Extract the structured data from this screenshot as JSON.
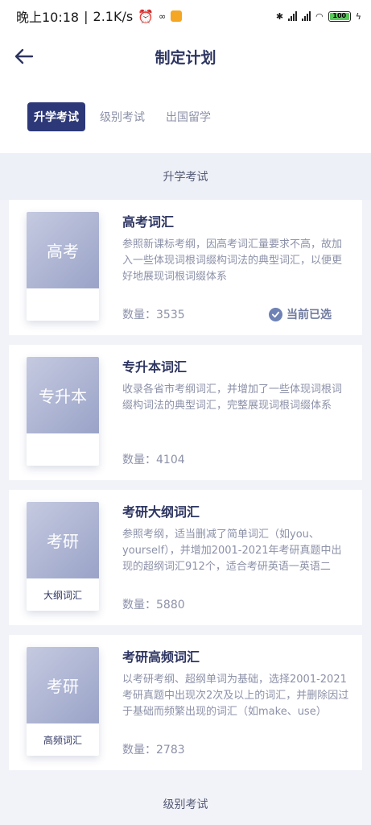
{
  "status": {
    "time": "晚上10:18",
    "speed": "2.1K/s",
    "battery": "100"
  },
  "nav": {
    "title": "制定计划"
  },
  "tabs": [
    {
      "label": "升学考试",
      "active": true
    },
    {
      "label": "级别考试",
      "active": false
    },
    {
      "label": "出国留学",
      "active": false
    }
  ],
  "sections": {
    "first": "升学考试",
    "second": "级别考试"
  },
  "books": [
    {
      "cover_main": "高考",
      "cover_sub": "",
      "title": "高考词汇",
      "desc": "参照新课标考纲，因高考词汇量要求不高，故加入一些体现词根词缀构词法的典型词汇，以便更好地展现词根词缀体系",
      "count": "数量：3535",
      "selected_label": "当前已选"
    },
    {
      "cover_main": "专升本",
      "cover_sub": "",
      "title": "专升本词汇",
      "desc": "收录各省市考纲词汇，并增加了一些体现词根词缀构词法的典型词汇，完整展现词根词缀体系",
      "count": "数量：4104"
    },
    {
      "cover_main": "考研",
      "cover_sub": "大纲词汇",
      "title": "考研大纲词汇",
      "desc": "参照考纲，适当删减了简单词汇（如you、yourself），并增加2001-2021年考研真题中出现的超纲词汇912个，适合考研英语一英语二",
      "count": "数量：5880"
    },
    {
      "cover_main": "考研",
      "cover_sub": "高频词汇",
      "title": "考研高频词汇",
      "desc": "以考研考纲、超纲单词为基础，选择2001-2021考研真题中出现次2次及以上的词汇，并删除因过于基础而频繁出现的词汇（如make、use）",
      "count": "数量：2783"
    }
  ]
}
